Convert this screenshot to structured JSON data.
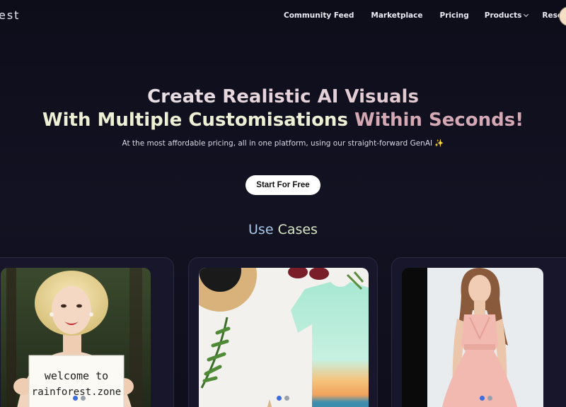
{
  "nav": {
    "logo": "est",
    "links": [
      {
        "label": "Community Feed"
      },
      {
        "label": "Marketplace"
      },
      {
        "label": "Pricing"
      },
      {
        "label": "Products",
        "dropdown": true
      },
      {
        "label": "Resources",
        "dropdown": true
      }
    ]
  },
  "hero": {
    "line1": "Create Realistic AI Visuals",
    "line2_a": "With Multiple Customisations ",
    "line2_b": "Within Seconds!",
    "subtitle": "At the most affordable pricing, all in one platform, using our straight-forward GenAI ✨",
    "cta_label": "Start For Free"
  },
  "use_cases": {
    "title_a": "Use",
    "title_b": "Cases",
    "cards": [
      {
        "sign_line1": "welcome to",
        "sign_line2": "rainforest.zone",
        "active_dot": 0
      },
      {
        "active_dot": 0
      },
      {
        "active_dot": 0
      }
    ]
  },
  "colors": {
    "background": "#0f0e1a",
    "card_bg": "#17162a",
    "dot_active": "#3d6be0",
    "dot_inactive": "#9aa0aa"
  }
}
